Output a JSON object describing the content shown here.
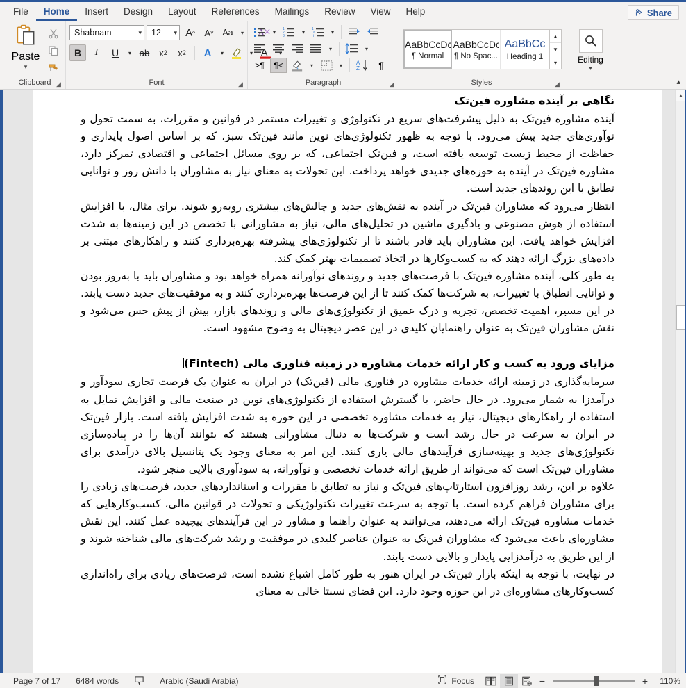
{
  "window": {
    "accent_color": "#2b579a"
  },
  "tabs": [
    {
      "label": "File",
      "active": false
    },
    {
      "label": "Home",
      "active": true
    },
    {
      "label": "Insert",
      "active": false
    },
    {
      "label": "Design",
      "active": false
    },
    {
      "label": "Layout",
      "active": false
    },
    {
      "label": "References",
      "active": false
    },
    {
      "label": "Mailings",
      "active": false
    },
    {
      "label": "Review",
      "active": false
    },
    {
      "label": "View",
      "active": false
    },
    {
      "label": "Help",
      "active": false
    }
  ],
  "share": {
    "label": "Share",
    "icon": "share-person-icon"
  },
  "ribbon": {
    "groups": {
      "clipboard": {
        "label": "Clipboard",
        "paste_label": "Paste",
        "items": [
          "paste-icon",
          "cut-scissors-icon",
          "copy-icon",
          "format-painter-icon"
        ]
      },
      "font": {
        "label": "Font",
        "font_name": "Shabnam",
        "font_size": "12",
        "grow_font": "A^",
        "shrink_font": "Av",
        "change_case": "Aa",
        "clear_formatting": "clear-formatting-icon",
        "bold": "B",
        "italic": "I",
        "underline": "U",
        "strikethrough": "ab",
        "subscript": "x₂",
        "superscript": "x²",
        "text_effects": "A",
        "highlight": "highlight-icon",
        "font_color": "A"
      },
      "paragraph": {
        "label": "Paragraph",
        "items": [
          "bullets-icon",
          "numbering-icon",
          "multilevel-list-icon",
          "decrease-indent-icon",
          "increase-indent-icon",
          "align-left-icon",
          "align-center-icon",
          "align-right-icon",
          "justify-icon",
          "line-spacing-icon",
          "ltr-text-direction-icon",
          "rtl-text-direction-icon",
          "shading-icon",
          "borders-icon",
          "sort-icon",
          "show-marks-icon"
        ]
      },
      "styles": {
        "label": "Styles",
        "items": [
          {
            "preview": "AaBbCcDc",
            "name": "¶ Normal",
            "selected": true,
            "heading": false
          },
          {
            "preview": "AaBbCcDc",
            "name": "¶ No Spac...",
            "selected": false,
            "heading": false
          },
          {
            "preview": "AaBbCс",
            "name": "Heading 1",
            "selected": false,
            "heading": true
          }
        ]
      },
      "editing": {
        "label": "Editing",
        "icon": "search-magnifier-icon"
      }
    }
  },
  "document": {
    "blocks": [
      {
        "type": "heading",
        "text": "نگاهی بر آینده مشاوره فین‌تک"
      },
      {
        "type": "para",
        "text": "آینده مشاوره فین‌تک به دلیل پیشرفت‌های سریع در تکنولوژی و تغییرات مستمر در قوانین و مقررات، به سمت تحول و نوآوری‌های جدید پیش می‌رود. با توجه به ظهور تکنولوژی‌های نوین مانند فین‌تک سبز، که بر اساس اصول پایداری و حفاظت از محیط زیست توسعه یافته است، و فین‌تک اجتماعی، که بر روی مسائل اجتماعی و اقتصادی تمرکز دارد، مشاوره فین‌تک در آینده به حوزه‌های جدیدی خواهد پرداخت. این تحولات به معنای نیاز به مشاوران با دانش روز و توانایی تطابق با این روندهای جدید است."
      },
      {
        "type": "para",
        "text": "انتظار می‌رود که مشاوران فین‌تک در آینده به نقش‌های جدید و چالش‌های بیشتری روبه‌رو شوند. برای مثال، با افزایش استفاده از هوش مصنوعی و یادگیری ماشین در تحلیل‌های مالی، نیاز به مشاورانی با تخصص در این زمینه‌ها به شدت افزایش خواهد یافت. این مشاوران باید قادر باشند تا از تکنولوژی‌های پیشرفته بهره‌برداری کنند و راهکارهای مبتنی بر داده‌های بزرگ ارائه دهند که به کسب‌وکارها در اتخاذ تصمیمات بهتر کمک کند."
      },
      {
        "type": "para",
        "text": "به طور کلی، آینده مشاوره فین‌تک با فرصت‌های جدید و روندهای نوآورانه همراه خواهد بود و مشاوران باید با به‌روز بودن و توانایی انطباق با تغییرات، به شرکت‌ها کمک کنند تا از این فرصت‌ها بهره‌برداری کنند و به موفقیت‌های جدید دست یابند. در این مسیر، اهمیت تخصص، تجربه و درک عمیق از تکنولوژی‌های مالی و روندهای بازار، بیش از پیش حس می‌شود و نقش مشاوران فین‌تک به عنوان راهنمایان کلیدی در این عصر دیجیتال به وضوح مشهود است."
      },
      {
        "type": "heading2",
        "text": "مزایای ورود به کسب و کار ارائه خدمات مشاوره در زمینه فناوری مالی (Fintech)"
      },
      {
        "type": "para",
        "text": "سرمایه‌گذاری در زمینه ارائه خدمات مشاوره در فناوری مالی (فین‌تک) در ایران به عنوان یک فرصت تجاری سودآور و درآمدزا به شمار می‌رود. در حال حاضر، با گسترش استفاده از تکنولوژی‌های نوین در صنعت مالی و افزایش تمایل به استفاده از راهکارهای دیجیتال، نیاز به خدمات مشاوره تخصصی در این حوزه به شدت افزایش یافته است. بازار فین‌تک در ایران به سرعت در حال رشد است و شرکت‌ها به دنبال مشاورانی هستند که بتوانند آن‌ها را در پیاده‌سازی تکنولوژی‌های جدید و بهینه‌سازی فرآیندهای مالی یاری کنند. این امر به معنای وجود یک پتانسیل بالای درآمدی برای مشاوران فین‌تک است که می‌تواند از طریق ارائه خدمات تخصصی و نوآورانه، به سودآوری بالایی منجر شود."
      },
      {
        "type": "para",
        "text": "علاوه بر این، رشد روزافزون استارتاپ‌های فین‌تک و نیاز به تطابق با مقررات و استانداردهای جدید، فرصت‌های زیادی را برای مشاوران فراهم کرده است. با توجه به سرعت تغییرات تکنولوژیکی و تحولات در قوانین مالی، کسب‌وکارهایی که خدمات مشاوره فین‌تک ارائه می‌دهند، می‌توانند به عنوان راهنما و مشاور در این فرآیندهای پیچیده عمل کنند. این نقش مشاوره‌ای باعث می‌شود که مشاوران فین‌تک به عنوان عناصر کلیدی در موفقیت و رشد شرکت‌های مالی شناخته شوند و از این طریق به درآمدزایی پایدار و بالایی دست یابند."
      },
      {
        "type": "para",
        "text": "در نهایت، با توجه به اینکه بازار فین‌تک در ایران هنوز به طور کامل اشباع نشده است، فرصت‌های زیادی برای راه‌اندازی کسب‌وکارهای مشاوره‌ای در این حوزه وجود دارد. این فضای نسبتا خالی به معنای"
      }
    ]
  },
  "status": {
    "page": "Page 7 of 17",
    "words": "6484 words",
    "proofing_icon": "proofing-errors-icon",
    "language": "Arabic (Saudi Arabia)",
    "focus": "Focus",
    "view_read": "read-mode-icon",
    "view_print": "print-layout-icon",
    "view_web": "web-layout-icon",
    "zoom_out": "−",
    "zoom_in": "+",
    "zoom_value": "110%"
  }
}
